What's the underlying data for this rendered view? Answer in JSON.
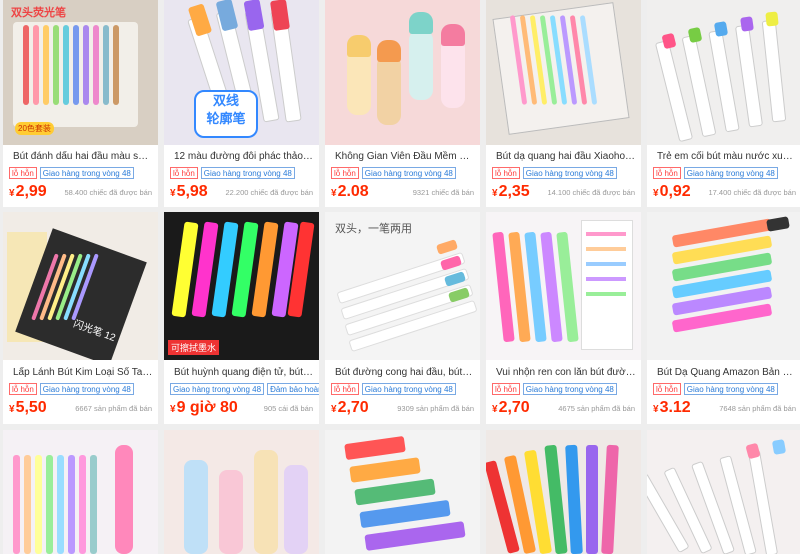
{
  "tags": {
    "not_match": "lỗ hỗn",
    "ship": "Giao hàng trong vòng 48",
    "guarantee": "Đảm bảo hoàn"
  },
  "products": [
    {
      "title": "Bút đánh dấu hai đầu màu sắc...",
      "tag1": "lỗ hỗn",
      "tag2": "Giao hàng trong vòng 48",
      "currency": "¥",
      "price": "2,99",
      "sold": "58.400 chiếc đã được bán",
      "image_text": "双头荧光笔",
      "image_badge": "20色套装"
    },
    {
      "title": "12 màu đường đôi phác thảo b...",
      "tag1": "lỗ hỗn",
      "tag2": "Giao hàng trong vòng 48",
      "currency": "¥",
      "price": "5,98",
      "sold": "22.200 chiếc đã được bán",
      "image_text": "双线\n轮廓笔"
    },
    {
      "title": "Không Gian Viên Đầu Mềm Ca...",
      "tag1": "lỗ hỗn",
      "tag2": "Giao hàng trong vòng 48",
      "currency": "¥",
      "price": "2.08",
      "sold": "9321 chiếc đã bán"
    },
    {
      "title": "Bút dạ quang hai đầu Xiaohon...",
      "tag1": "lỗ hỗn",
      "tag2": "Giao hàng trong vòng 48",
      "currency": "¥",
      "price": "2,35",
      "sold": "14.100 chiếc đã được bán"
    },
    {
      "title": "Trẻ em cối bút màu nước xuyê...",
      "tag1": "lỗ hỗn",
      "tag2": "Giao hàng trong vòng 48",
      "currency": "¥",
      "price": "0,92",
      "sold": "17.400 chiếc đã được bán"
    },
    {
      "title": "Lấp Lánh Bút Kim Loại Sổ Tay ...",
      "tag1": "lỗ hỗn",
      "tag2": "Giao hàng trong vòng 48",
      "currency": "¥",
      "price": "5,50",
      "sold": "6667 sản phẩm đã bán",
      "image_text": "闪光笔 12"
    },
    {
      "title": "Bút huỳnh quang điện tử, bút ...",
      "tag1": "Giao hàng trong vòng 48",
      "tag2": "Đảm bảo hoàn",
      "currency": "¥",
      "price": "9 giờ 80",
      "sold": "905 cái đã bán",
      "image_text": "可擦拭墨水"
    },
    {
      "title": "Bút đường cong hai đầu, bút r...",
      "tag1": "lỗ hỗn",
      "tag2": "Giao hàng trong vòng 48",
      "currency": "¥",
      "price": "2,70",
      "sold": "9309 sản phẩm đã bán",
      "image_text": "双头，一笔两用"
    },
    {
      "title": "Vui nhộn ren con lăn bút đườn...",
      "tag1": "lỗ hỗn",
      "tag2": "Giao hàng trong vòng 48",
      "currency": "¥",
      "price": "2,70",
      "sold": "4675 sản phẩm đã bán"
    },
    {
      "title": "Bút Dạ Quang Amazon Bản Ch...",
      "tag1": "lỗ hỗn",
      "tag2": "Giao hàng trong vòng 48",
      "currency": "¥",
      "price": "3.12",
      "sold": "7648 sản phẩm đã bán"
    },
    {
      "title": "",
      "tag1": "",
      "tag2": "",
      "currency": "",
      "price": "",
      "sold": ""
    },
    {
      "title": "",
      "tag1": "",
      "tag2": "",
      "currency": "",
      "price": "",
      "sold": ""
    },
    {
      "title": "",
      "tag1": "",
      "tag2": "",
      "currency": "",
      "price": "",
      "sold": ""
    },
    {
      "title": "",
      "tag1": "",
      "tag2": "",
      "currency": "",
      "price": "",
      "sold": ""
    },
    {
      "title": "",
      "tag1": "",
      "tag2": "",
      "currency": "",
      "price": "",
      "sold": ""
    }
  ],
  "colors": {
    "price": "#ff2a00",
    "tag_red": "#ff3b3b",
    "tag_blue": "#2a7bd8",
    "page_bg": "#eeeeee"
  }
}
